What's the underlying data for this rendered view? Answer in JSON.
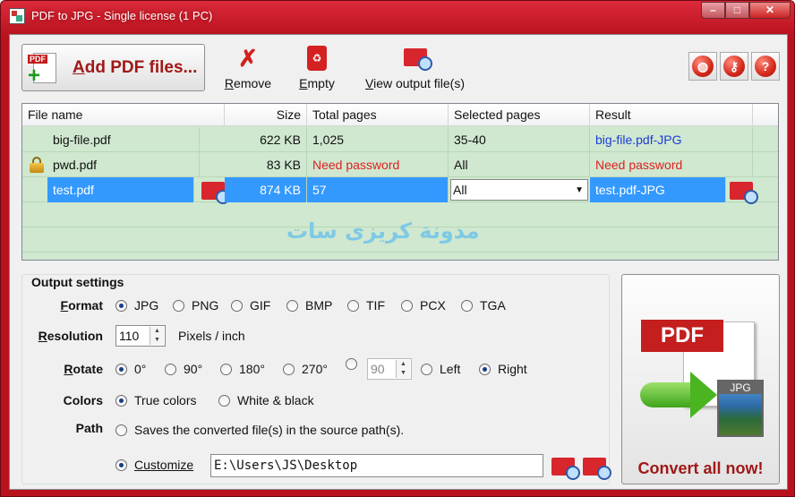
{
  "window": {
    "title": "PDF to JPG - Single license (1 PC)",
    "controls": {
      "minimize": "–",
      "maximize": "□",
      "close": "✕"
    }
  },
  "toolbar": {
    "add_label_accel": "A",
    "add_label_rest": "dd PDF files...",
    "remove_accel": "R",
    "remove_rest": "emove",
    "empty_accel": "E",
    "empty_rest": "mpty",
    "view_accel": "V",
    "view_rest": "iew output file(s)",
    "round_buttons": [
      {
        "icon": "globe-icon",
        "glyph": "◍"
      },
      {
        "icon": "key-icon",
        "glyph": "⚷"
      },
      {
        "icon": "help-icon",
        "glyph": "?"
      }
    ]
  },
  "file_list": {
    "columns": [
      "File name",
      "Size",
      "Total pages",
      "Selected pages",
      "Result"
    ],
    "rows": [
      {
        "name": "big-file.pdf",
        "size": "622 KB",
        "pages": "1,025",
        "selected": "35-40",
        "result": "big-file.pdf-JPG",
        "locked": false,
        "status": "ok"
      },
      {
        "name": "pwd.pdf",
        "size": "83 KB",
        "pages": "Need password",
        "selected": "All",
        "result": "Need password",
        "locked": true,
        "status": "needs-password"
      },
      {
        "name": "test.pdf",
        "size": "874 KB",
        "pages": "57",
        "selected": "All",
        "result": "test.pdf-JPG",
        "locked": false,
        "status": "selected"
      }
    ],
    "watermark": "مدونة كريزى سات"
  },
  "settings": {
    "title": "Output settings",
    "format": {
      "label_accel": "F",
      "label_rest": "ormat",
      "options": [
        "JPG",
        "PNG",
        "GIF",
        "BMP",
        "TIF",
        "PCX",
        "TGA"
      ],
      "selected": "JPG"
    },
    "resolution": {
      "label_accel": "R",
      "label_pre": "",
      "label_rest": "esolution",
      "value": "110",
      "unit": "Pixels / inch"
    },
    "rotate": {
      "label_accel": "R",
      "label_rest": "otate",
      "options": [
        "0°",
        "90°",
        "180°",
        "270°"
      ],
      "selected": "0°",
      "custom_value": "90",
      "left": "Left",
      "right": "Right",
      "direction": "Right"
    },
    "colors": {
      "label": "Colors",
      "options": [
        "True colors",
        "White & black"
      ],
      "selected": "True colors"
    },
    "path": {
      "label": "Path",
      "source_option": "Saves the converted file(s) in the source path(s).",
      "custom_option": "Customize",
      "selected": "Customize",
      "value": "E:\\Users\\JS\\Desktop"
    }
  },
  "convert": {
    "pdf_badge": "PDF",
    "jpg_badge": "JPG",
    "label": "Convert all now!"
  },
  "colors": {
    "frame": "#b8121f",
    "accent_text": "#a01818",
    "list_bg": "#cfe8cf",
    "selection": "#3399ff",
    "error_text": "#e02020",
    "link_text": "#1c3cd6"
  }
}
